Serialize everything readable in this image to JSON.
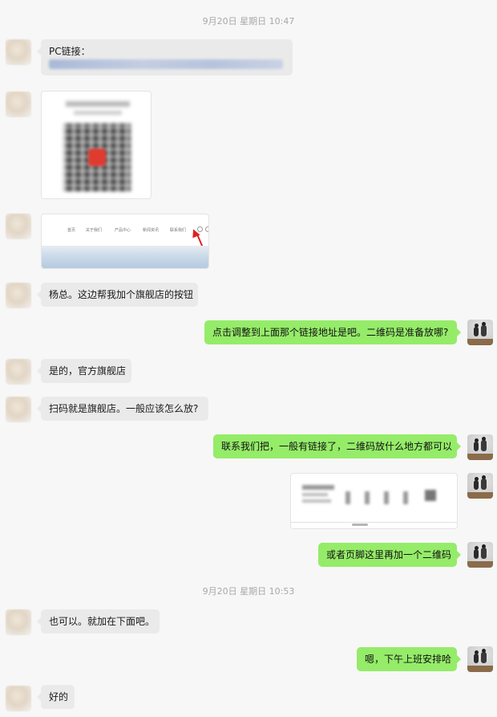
{
  "timestamps": [
    "9月20日 星期日 10:47",
    "9月20日 星期日 10:53"
  ],
  "messages": {
    "pc_label": "PC链接：",
    "m_yangzong": "杨总。这边帮我加个旗舰店的按钮",
    "m_confirm": "点击调整到上面那个链接地址是吧。二维码是准备放哪?",
    "m_official": "是的，官方旗舰店",
    "m_scan": "扫码就是旗舰店。一般应该怎么放?",
    "m_contact": "联系我们把，一般有链接了，二维码放什么地方都可以",
    "m_footer": "或者页脚这里再加一个二维码",
    "m_ok_below": "也可以。就加在下面吧。",
    "m_arrange": "嗯，下午上班安排哈",
    "m_fine": "好的"
  },
  "website_nav": [
    "首页",
    "关于我们",
    "产品中心",
    "新闻资讯",
    "联系我们"
  ],
  "colors": {
    "background": "#f7f7f7",
    "incoming_bubble": "#eaeaea",
    "outgoing_bubble": "#95ec69",
    "timestamp": "#a8a8a8",
    "arrow": "#e02020"
  }
}
